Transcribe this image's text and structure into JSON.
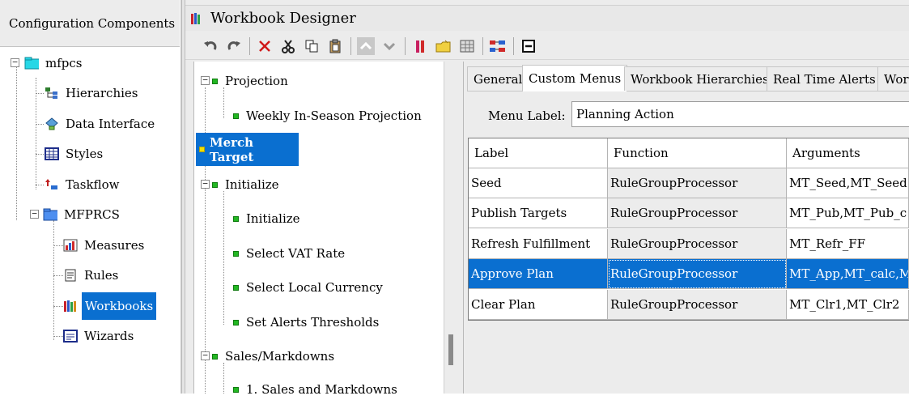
{
  "left_panel": {
    "title": "Configuration Components",
    "tree": {
      "root": "mfpcs",
      "items": [
        "Hierarchies",
        "Data Interface",
        "Styles",
        "Taskflow"
      ],
      "project": "MFPRCS",
      "project_items": [
        "Measures",
        "Rules",
        "Workbooks",
        "Wizards"
      ],
      "selected": "Workbooks"
    }
  },
  "designer": {
    "title": "Workbook Designer",
    "toolbar": [
      "undo-icon",
      "redo-icon",
      "delete-icon",
      "cut-icon",
      "copy-icon",
      "paste-icon",
      "move-up-icon",
      "move-down-icon",
      "color-icon",
      "folder-icon",
      "grid-icon",
      "flow-icon",
      "collapse-icon"
    ]
  },
  "workbook_tree": {
    "projection": "Projection",
    "weekly": "Weekly In-Season Projection",
    "merch_target": "Merch Target",
    "initialize": "Initialize",
    "init_items": [
      "Initialize",
      "Select VAT Rate",
      "Select Local Currency",
      "Set Alerts Thresholds"
    ],
    "sales": "Sales/Markdowns",
    "sales_item": "1. Sales and Markdowns"
  },
  "properties": {
    "tabs": [
      "General",
      "Custom Menus",
      "Workbook Hierarchies",
      "Real Time Alerts",
      "Wor"
    ],
    "active_tab": "Custom Menus",
    "menu_label_caption": "Menu Label:",
    "menu_label_value": "Planning Action",
    "grid": {
      "headers": [
        "Label",
        "Function",
        "Arguments"
      ],
      "rows": [
        [
          "Seed",
          "RuleGroupProcessor",
          "MT_Seed,MT_Seed"
        ],
        [
          "Publish Targets",
          "RuleGroupProcessor",
          "MT_Pub,MT_Pub_c"
        ],
        [
          "Refresh Fulfillment",
          "RuleGroupProcessor",
          "MT_Refr_FF"
        ],
        [
          "Approve Plan",
          "RuleGroupProcessor",
          "MT_App,MT_calc,M"
        ],
        [
          "Clear Plan",
          "RuleGroupProcessor",
          "MT_Clr1,MT_Clr2"
        ]
      ],
      "selected_row": "Approve Plan"
    }
  },
  "colors": {
    "selection": "#0a6fd0",
    "node_green": "#22b722",
    "node_yellow": "#f2e000"
  }
}
